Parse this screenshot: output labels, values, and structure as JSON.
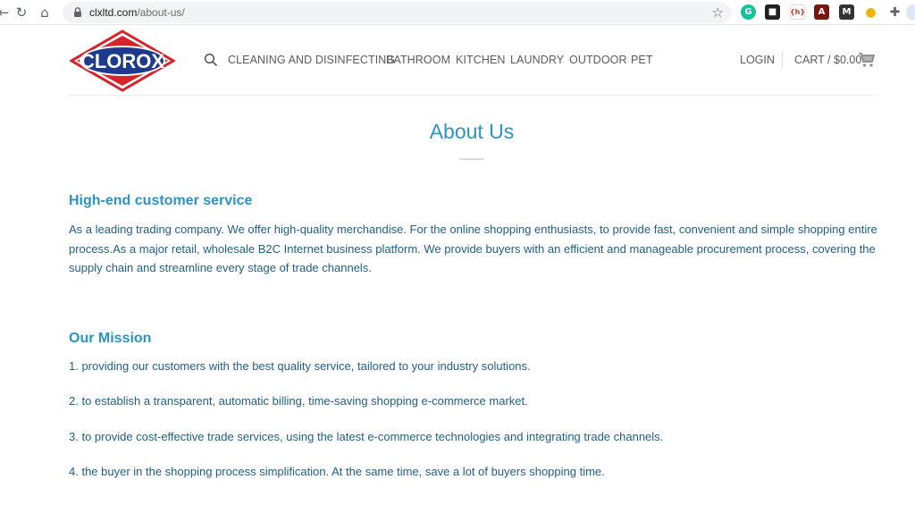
{
  "browser": {
    "url_domain": "clxltd.com",
    "url_path": "/about-us/",
    "back_glyph": "←",
    "reload_glyph": "↻",
    "home_glyph": "⌂",
    "star_glyph": "☆",
    "extensions": [
      {
        "name": "grammarly-icon",
        "glyph": "G",
        "color": "#15c39a"
      },
      {
        "name": "tab-extension-icon",
        "glyph": "■",
        "color": "#222222"
      },
      {
        "name": "rss-extension-icon",
        "glyph": "{h}",
        "color": "#e8e8e8"
      },
      {
        "name": "pdf-icon",
        "glyph": "A",
        "color": "#7a1613"
      },
      {
        "name": "m-extension-icon",
        "glyph": "M",
        "color": "#333333"
      },
      {
        "name": "colorful-extension-icon",
        "glyph": "●",
        "color": "#f0b400"
      },
      {
        "name": "extensions-puzzle-icon",
        "glyph": "✚",
        "color": "#5f6368"
      }
    ]
  },
  "brand": {
    "logo_text": "CLOROX",
    "colors": {
      "navy": "#1d3a8c",
      "red": "#d6242b",
      "accent": "#2a94c4"
    }
  },
  "nav": {
    "items": [
      "CLEANING AND DISINFECTING",
      "BATHROOM",
      "KITCHEN",
      "LAUNDRY",
      "OUTDOOR",
      "PET"
    ],
    "login": "LOGIN",
    "cart": "CART / $0.00"
  },
  "main": {
    "title": "About Us",
    "sections": [
      {
        "heading": "High-end customer service",
        "body": "As a leading trading company. We offer high-quality merchandise. For the online shopping enthusiasts, to provide fast, convenient and simple shopping entire process.As a major retail, wholesale B2C Internet business platform. We provide buyers with an efficient and manageable procurement process, covering the supply chain and streamline every stage of trade channels."
      },
      {
        "heading": "Our Mission",
        "items": [
          "1. providing our customers with the best quality service, tailored to your industry solutions.",
          "2. to establish a transparent, automatic billing, time-saving shopping e-commerce market.",
          "3. to provide cost-effective trade services, using the latest e-commerce technologies and integrating trade channels.",
          "4. the buyer in the shopping process simplification. At the same time, save a lot of buyers shopping time."
        ]
      }
    ]
  }
}
